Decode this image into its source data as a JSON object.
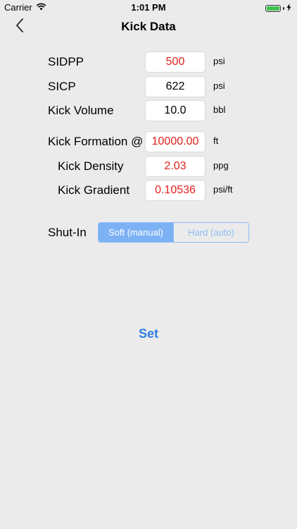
{
  "status_bar": {
    "carrier": "Carrier",
    "time": "1:01 PM",
    "battery_level": 1.0,
    "icons": [
      "wifi-icon",
      "battery-icon",
      "charging-icon"
    ]
  },
  "nav": {
    "title": "Kick Data",
    "back_icon": "chevron-left-icon"
  },
  "fields": {
    "sidpp": {
      "label": "SIDPP",
      "value": "500",
      "unit": "psi"
    },
    "sicp": {
      "label": "SICP",
      "value": "622",
      "unit": "psi"
    },
    "kick_volume": {
      "label": "Kick Volume",
      "value": "10.0",
      "unit": "bbl"
    },
    "kick_formation": {
      "label": "Kick Formation @",
      "value": "10000.00",
      "unit": "ft"
    },
    "kick_density": {
      "label": "Kick Density",
      "value": "2.03",
      "unit": "ppg"
    },
    "kick_gradient": {
      "label": "Kick Gradient",
      "value": "0.10536",
      "unit": "psi/ft"
    }
  },
  "shut_in": {
    "label": "Shut-In",
    "options": [
      "Soft (manual)",
      "Hard (auto)"
    ],
    "selected": "Soft (manual)"
  },
  "actions": {
    "set_label": "Set"
  },
  "colors": {
    "background": "#ebebeb",
    "value_red": "#e0211b",
    "accent_blue": "#2f7fe0",
    "segment_blue": "#7cb2f4"
  }
}
